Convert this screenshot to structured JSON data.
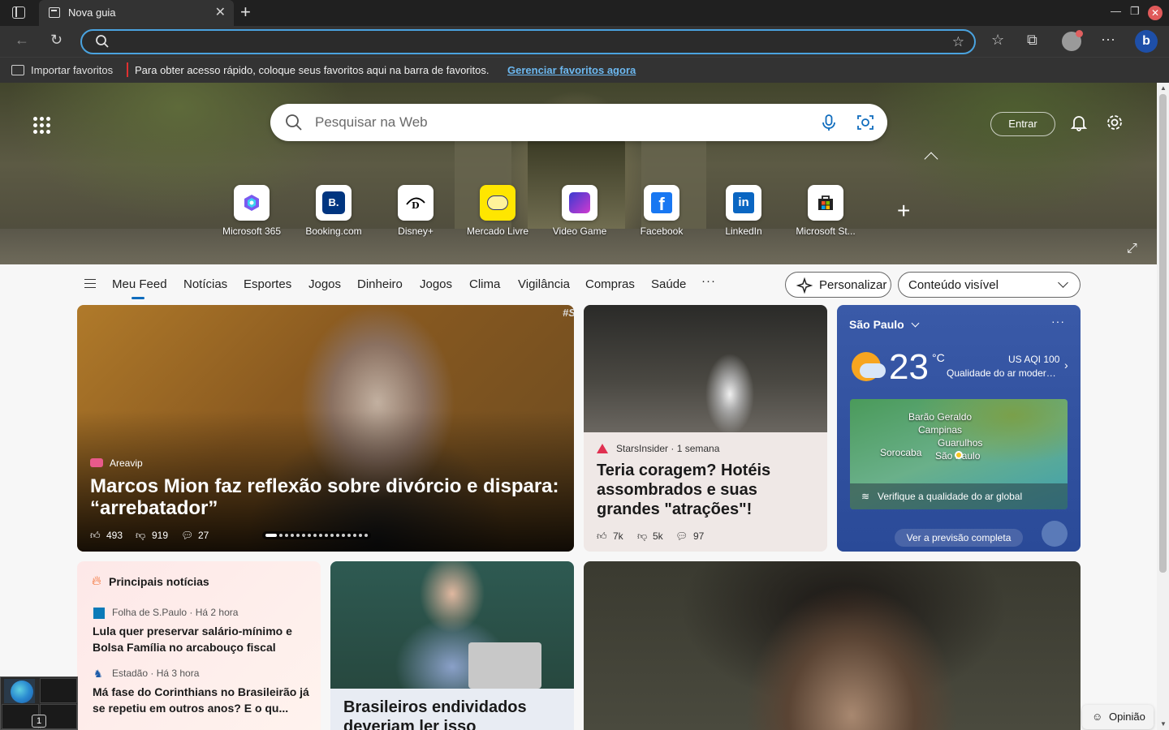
{
  "browser": {
    "tab_title": "Nova guia",
    "tab_close": "✕",
    "address_value": "",
    "favorites_bar": {
      "import_label": "Importar favoritos",
      "message": "Para obter acesso rápido, coloque seus favoritos aqui na barra de favoritos.",
      "manage_link": "Gerenciar favoritos agora"
    }
  },
  "hero": {
    "search_placeholder": "Pesquisar na Web",
    "sign_in": "Entrar",
    "quick_links": [
      {
        "label": "Microsoft 365"
      },
      {
        "label": "Booking.com"
      },
      {
        "label": "Disney+"
      },
      {
        "label": "Mercado Livre"
      },
      {
        "label": "Video Game"
      },
      {
        "label": "Facebook"
      },
      {
        "label": "LinkedIn"
      },
      {
        "label": "Microsoft St..."
      }
    ]
  },
  "feed_nav": {
    "items": [
      "Meu Feed",
      "Notícias",
      "Esportes",
      "Jogos",
      "Dinheiro",
      "Jogos",
      "Clima",
      "Vigilância",
      "Compras",
      "Saúde"
    ],
    "more": "···",
    "personalize": "Personalizar",
    "content_visible": "Conteúdo visível"
  },
  "cards": {
    "featured": {
      "source": "Areavip",
      "headline": "Marcos Mion faz reflexão sobre divórcio e dispara: “arrebatador”",
      "likes": "493",
      "dislikes": "919",
      "comments": "27",
      "watermark": "#S"
    },
    "second": {
      "source": "StarsInsider · 1 semana",
      "headline": "Teria coragem? Hotéis assombrados e suas grandes \"atrações\"!",
      "likes": "7k",
      "dislikes": "5k",
      "comments": "97"
    },
    "weather": {
      "city": "São Paulo",
      "temperature": "23",
      "unit": "°C",
      "aqi": "US AQI 100",
      "aqi_desc": "Qualidade do ar moderada",
      "map_labels": [
        "Barão Geraldo",
        "Campinas",
        "Guarulhos",
        "Sorocaba",
        "São Paulo"
      ],
      "map_cta": "Verifique a qualidade do ar global",
      "forecast_link": "Ver a previsão completa"
    },
    "top_news": {
      "heading": "Principais notícias",
      "items": [
        {
          "source": "Folha de S.Paulo · Há 2 hora",
          "title": "Lula quer preservar salário-mínimo e Bolsa Família no arcabouço fiscal"
        },
        {
          "source": "Estadão · Há 3 hora",
          "title": "Má fase do Corinthians no Brasileirão já se repetiu em outros anos? E o qu..."
        }
      ]
    },
    "fifth": {
      "headline": "Brasileiros endividados deveriam ler isso"
    }
  },
  "feedback": "Opinião",
  "taskbar_badge": "1"
}
